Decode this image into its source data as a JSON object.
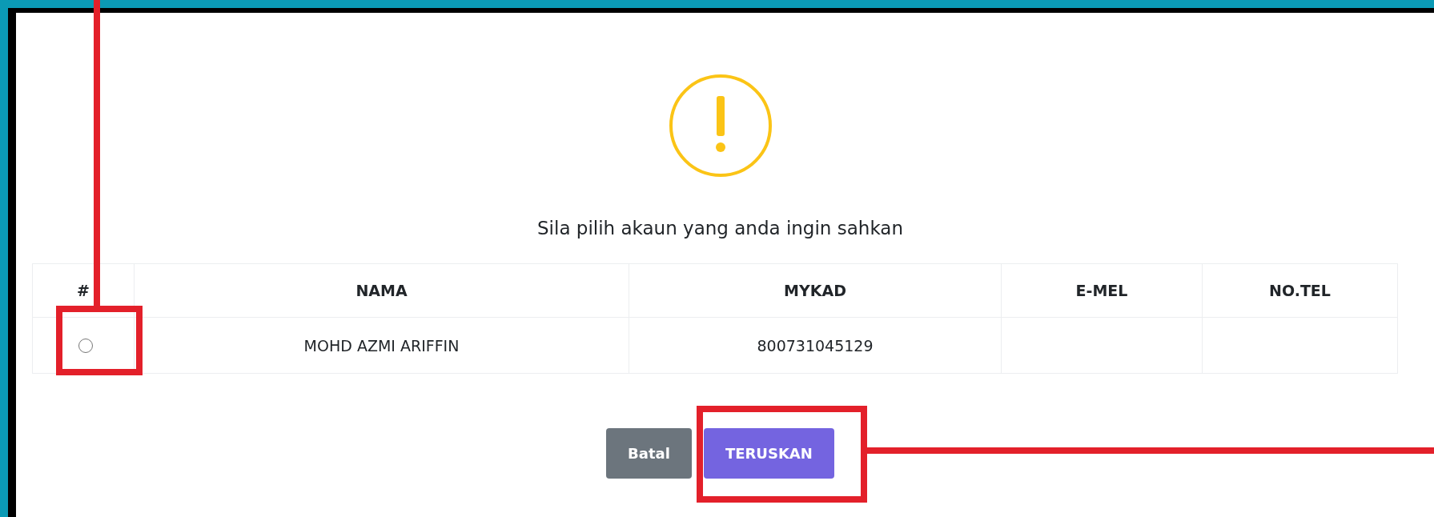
{
  "dialog": {
    "message": "Sila pilih akaun yang anda ingin sahkan"
  },
  "table": {
    "columns": [
      "#",
      "NAMA",
      "MYKAD",
      "E-MEL",
      "NO.TEL"
    ],
    "rows": [
      {
        "selected": false,
        "cells": [
          "",
          "MOHD AZMI ARIFFIN",
          "800731045129",
          "",
          ""
        ]
      }
    ]
  },
  "buttons": [
    {
      "label": "Batal",
      "kind": "secondary"
    },
    {
      "label": "TERUSKAN",
      "kind": "primary"
    }
  ]
}
